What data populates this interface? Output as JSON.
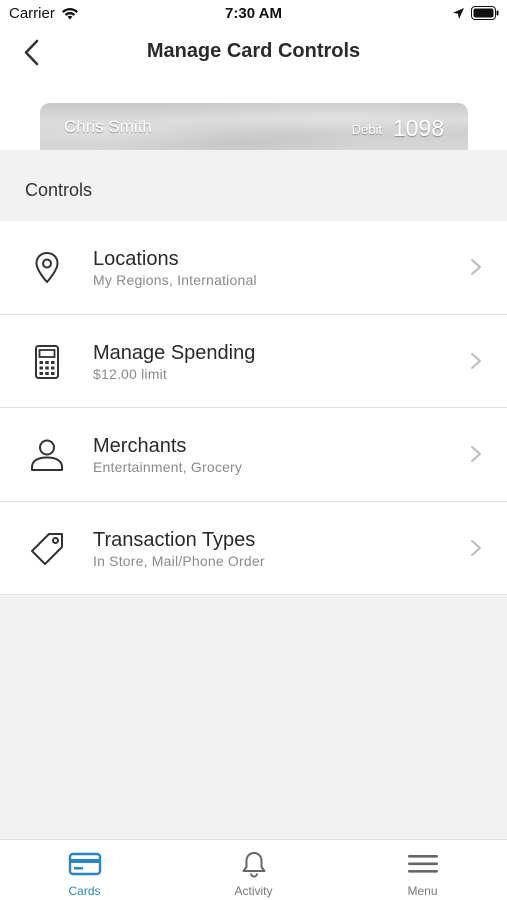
{
  "status_bar": {
    "carrier": "Carrier",
    "time": "7:30 AM",
    "icons": [
      "wifi-icon",
      "location-arrow-icon",
      "battery-icon"
    ]
  },
  "header": {
    "title": "Manage Card Controls",
    "back_icon": "chevron-left-icon"
  },
  "card": {
    "holder_name": "Chris Smith",
    "type": "Debit",
    "last4": "1098"
  },
  "section": {
    "label": "Controls"
  },
  "controls": [
    {
      "icon": "location-pin-icon",
      "title": "Locations",
      "subtitle": "My Regions, International"
    },
    {
      "icon": "calculator-icon",
      "title": "Manage Spending",
      "subtitle": "$12.00 limit"
    },
    {
      "icon": "person-icon",
      "title": "Merchants",
      "subtitle": "Entertainment, Grocery"
    },
    {
      "icon": "tag-icon",
      "title": "Transaction Types",
      "subtitle": "In Store, Mail/Phone Order"
    }
  ],
  "tab_bar": {
    "tabs": [
      {
        "icon": "card-icon",
        "label": "Cards",
        "active": true
      },
      {
        "icon": "bell-icon",
        "label": "Activity",
        "active": false
      },
      {
        "icon": "menu-icon",
        "label": "Menu",
        "active": false
      }
    ]
  },
  "colors": {
    "accent": "#2a84c8",
    "background": "#f2f2f2",
    "row_background": "#ffffff",
    "subtitle_text": "#8a8a8a"
  }
}
